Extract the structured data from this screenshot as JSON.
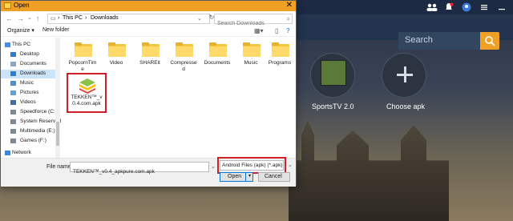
{
  "dialog": {
    "title": "Open",
    "breadcrumb": [
      "This PC",
      "Downloads"
    ],
    "search_placeholder": "Search Downloads",
    "toolbar": {
      "organize": "Organize",
      "new_folder": "New folder"
    }
  },
  "nav_items": [
    {
      "label": "This PC",
      "icon": "computer-icon"
    },
    {
      "label": "Desktop",
      "icon": "desktop-icon"
    },
    {
      "label": "Documents",
      "icon": "documents-icon"
    },
    {
      "label": "Downloads",
      "icon": "downloads-icon",
      "selected": true
    },
    {
      "label": "Music",
      "icon": "music-icon"
    },
    {
      "label": "Pictures",
      "icon": "pictures-icon"
    },
    {
      "label": "Videos",
      "icon": "videos-icon"
    },
    {
      "label": "Speedforce (C:)",
      "icon": "drive-icon"
    },
    {
      "label": "System Reserved",
      "icon": "drive-icon"
    },
    {
      "label": "Multimedia (E:)",
      "icon": "drive-icon"
    },
    {
      "label": "Games (F:)",
      "icon": "drive-icon"
    },
    {
      "label": "Network",
      "icon": "network-icon"
    }
  ],
  "files": [
    {
      "label": "PopcornTime",
      "label_lines": [
        "PopcornTim",
        "e"
      ]
    },
    {
      "label": "Video",
      "label_lines": [
        "Video"
      ]
    },
    {
      "label": "SHAREit",
      "label_lines": [
        "SHAREit"
      ]
    },
    {
      "label": "Compressed",
      "label_lines": [
        "Compresse",
        "d"
      ]
    },
    {
      "label": "Documents",
      "label_lines": [
        "Documents"
      ]
    },
    {
      "label": "Music",
      "label_lines": [
        "Music"
      ]
    },
    {
      "label": "Programs",
      "label_lines": [
        "Programs"
      ]
    }
  ],
  "apk_file": {
    "label_lines": [
      "TEKKEN™_v",
      "0.4.com.apk"
    ]
  },
  "footer": {
    "filename_label": "File name:",
    "filename_value": "TEKKEN™_v0.4_apkpure.com.apk",
    "filter_value": "Android Files (apk) (*.apk)",
    "open_label": "Open",
    "cancel_label": "Cancel"
  },
  "background": {
    "search_label": "Search",
    "tiles": [
      {
        "label": "SportsTV 2.0"
      },
      {
        "label": "Choose apk"
      }
    ]
  },
  "colors": {
    "title_bar": "#f0a025",
    "highlight_border": "#d2202a",
    "selection": "#cce4f7"
  }
}
